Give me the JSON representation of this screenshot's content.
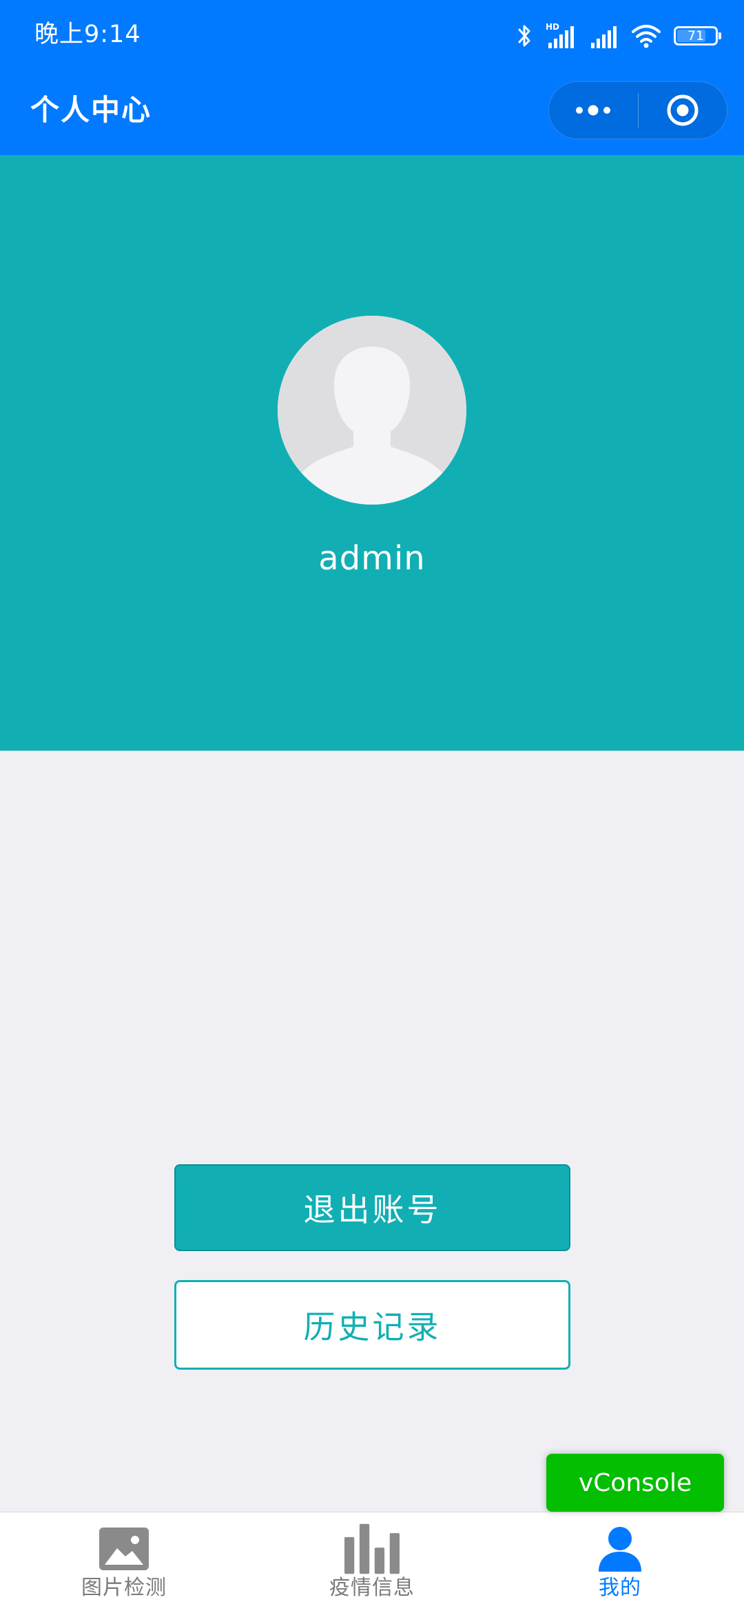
{
  "status_bar": {
    "time": "晚上9:14",
    "network_label": "HD",
    "battery": "71",
    "icons": [
      "bluetooth-icon",
      "signal-hd-icon",
      "signal-icon",
      "wifi-icon",
      "battery-icon"
    ]
  },
  "nav": {
    "title": "个人中心",
    "capsule": {
      "more_icon": "more-dots-icon",
      "close_icon": "target-circle-icon"
    }
  },
  "profile": {
    "username": "admin",
    "avatar_icon": "default-avatar-icon"
  },
  "actions": {
    "logout_label": "退出账号",
    "history_label": "历史记录"
  },
  "vconsole": {
    "label": "vConsole"
  },
  "tab_bar": {
    "active_index": 2,
    "tabs": [
      {
        "label": "图片检测",
        "icon": "image-icon"
      },
      {
        "label": "疫情信息",
        "icon": "bar-chart-icon"
      },
      {
        "label": "我的",
        "icon": "user-icon"
      }
    ]
  },
  "colors": {
    "nav_blue": "#027aff",
    "teal": "#11afb4",
    "background": "#efeff4",
    "vconsole_green": "#04be02",
    "tab_inactive": "#7a7a7a"
  }
}
